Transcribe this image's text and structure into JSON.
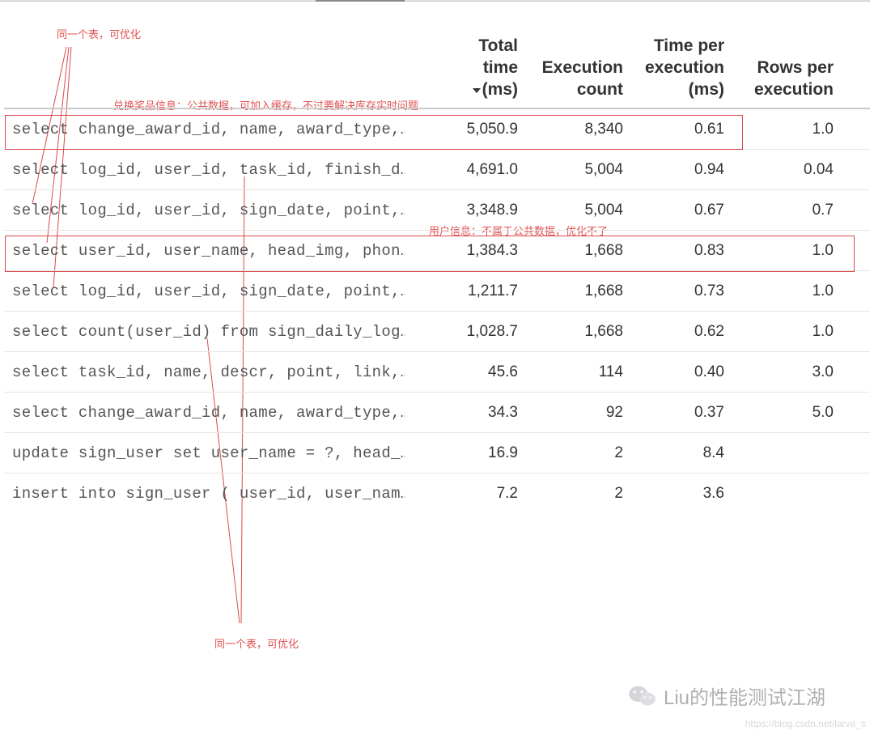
{
  "annotations": {
    "top_left": "同一个表，可优化",
    "note1": "兑换奖品信息：公共数据，可加入缓存，不过要解决库存实时问题",
    "note2": "用户信息：不属于公共数据，优化不了",
    "bottom": "同一个表，可优化"
  },
  "headers": {
    "total_time_l1": "Total",
    "total_time_l2": "time",
    "total_time_l3": "(ms)",
    "exec_count_l1": "Execution",
    "exec_count_l2": "count",
    "tpe_l1": "Time per",
    "tpe_l2": "execution",
    "tpe_l3": "(ms)",
    "rpe_l1": "Rows per",
    "rpe_l2": "execution"
  },
  "rows": [
    {
      "sql": "select change_award_id, name, award_type,…",
      "total": "5,050.9",
      "exec": "8,340",
      "tpe": "0.61",
      "rpe": "1.0"
    },
    {
      "sql": "select log_id, user_id, task_id, finish_d…",
      "total": "4,691.0",
      "exec": "5,004",
      "tpe": "0.94",
      "rpe": "0.04"
    },
    {
      "sql": "select log_id, user_id, sign_date, point,…",
      "total": "3,348.9",
      "exec": "5,004",
      "tpe": "0.67",
      "rpe": "0.7"
    },
    {
      "sql": "select user_id, user_name, head_img, phon…",
      "total": "1,384.3",
      "exec": "1,668",
      "tpe": "0.83",
      "rpe": "1.0"
    },
    {
      "sql": "select log_id, user_id, sign_date, point,…",
      "total": "1,211.7",
      "exec": "1,668",
      "tpe": "0.73",
      "rpe": "1.0"
    },
    {
      "sql": "select count(user_id) from sign_daily_log…",
      "total": "1,028.7",
      "exec": "1,668",
      "tpe": "0.62",
      "rpe": "1.0"
    },
    {
      "sql": "select task_id, name, descr, point, link,…",
      "total": "45.6",
      "exec": "114",
      "tpe": "0.40",
      "rpe": "3.0"
    },
    {
      "sql": "select change_award_id, name, award_type,…",
      "total": "34.3",
      "exec": "92",
      "tpe": "0.37",
      "rpe": "5.0"
    },
    {
      "sql": "update sign_user set user_name = ?, head_…",
      "total": "16.9",
      "exec": "2",
      "tpe": "8.4",
      "rpe": ""
    },
    {
      "sql": "insert into sign_user ( user_id, user_nam…",
      "total": "7.2",
      "exec": "2",
      "tpe": "3.6",
      "rpe": ""
    }
  ],
  "watermark": {
    "text": "Liu的性能测试江湖",
    "url": "https://blog.csdn.net/larva_s"
  }
}
